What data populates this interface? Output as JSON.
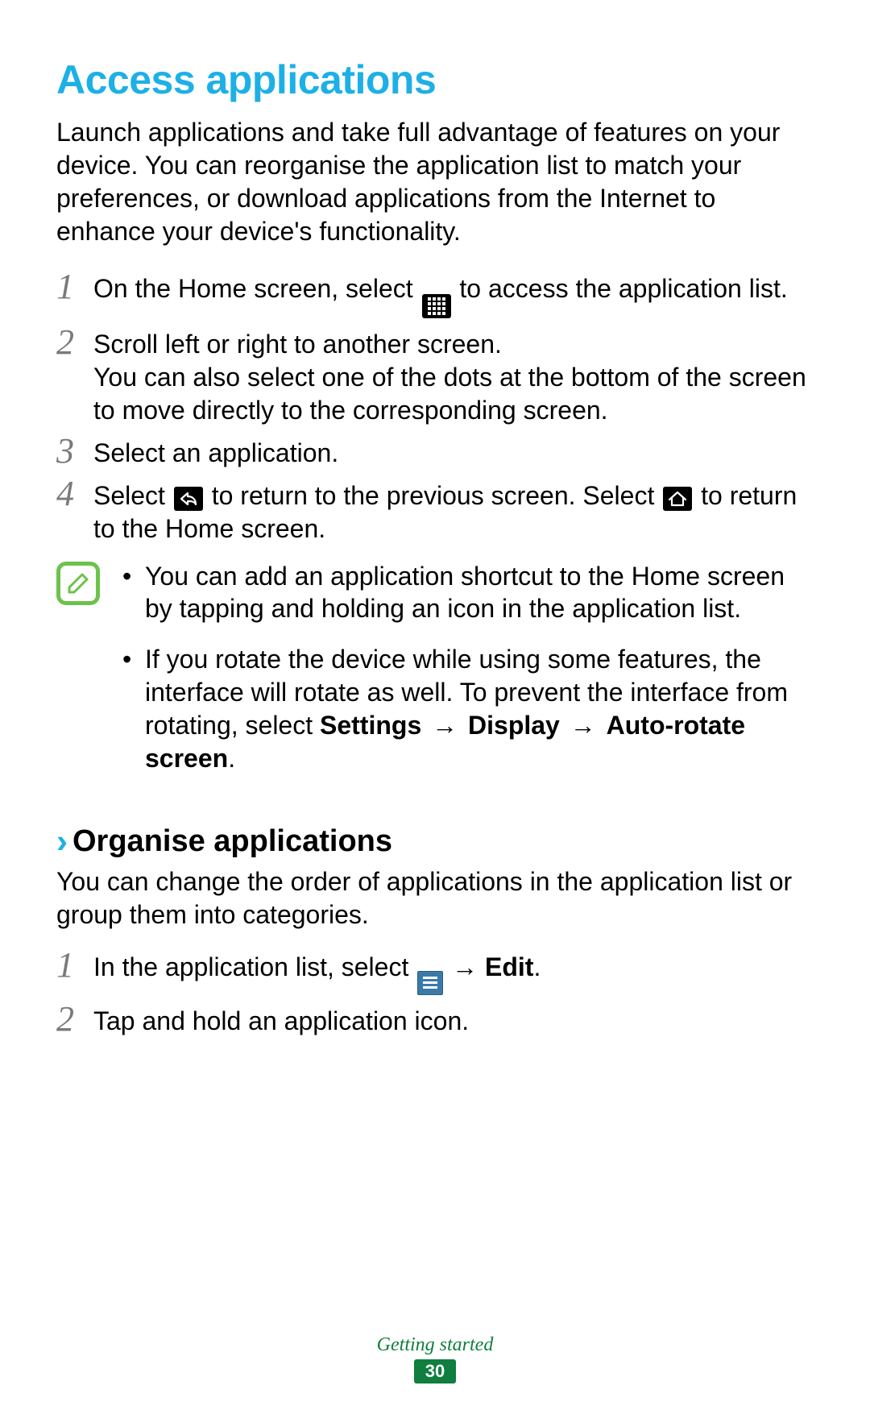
{
  "heading": "Access applications",
  "intro": "Launch applications and take full advantage of features on your device. You can reorganise the application list to match your preferences, or download applications from the Internet to enhance your device's functionality.",
  "steps": {
    "s1_num": "1",
    "s1_a": "On the Home screen, select ",
    "s1_b": " to access the application list.",
    "s2_num": "2",
    "s2_a": "Scroll left or right to another screen.",
    "s2_b": "You can also select one of the dots at the bottom of the screen to move directly to the corresponding screen.",
    "s3_num": "3",
    "s3_a": "Select an application.",
    "s4_num": "4",
    "s4_a": "Select ",
    "s4_b": " to return to the previous screen. Select ",
    "s4_c": " to return to the Home screen."
  },
  "notes": {
    "n1": "You can add an application shortcut to the Home screen by tapping and holding an icon in the application list.",
    "n2_a": "If you rotate the device while using some features, the interface will rotate as well. To prevent the interface from rotating, select ",
    "n2_b": "Settings",
    "n2_c": "Display",
    "n2_d": "Auto-rotate screen",
    "arrow": "→",
    "period": "."
  },
  "sub": {
    "chevron": "›",
    "heading": "Organise applications",
    "intro": "You can change the order of applications in the application list or group them into categories.",
    "s1_num": "1",
    "s1_a": "In the application list, select ",
    "s1_arrow": " → ",
    "s1_b": "Edit",
    "s1_c": ".",
    "s2_num": "2",
    "s2_a": "Tap and hold an application icon."
  },
  "footer": {
    "section": "Getting started",
    "page": "30"
  },
  "bullet": "•"
}
